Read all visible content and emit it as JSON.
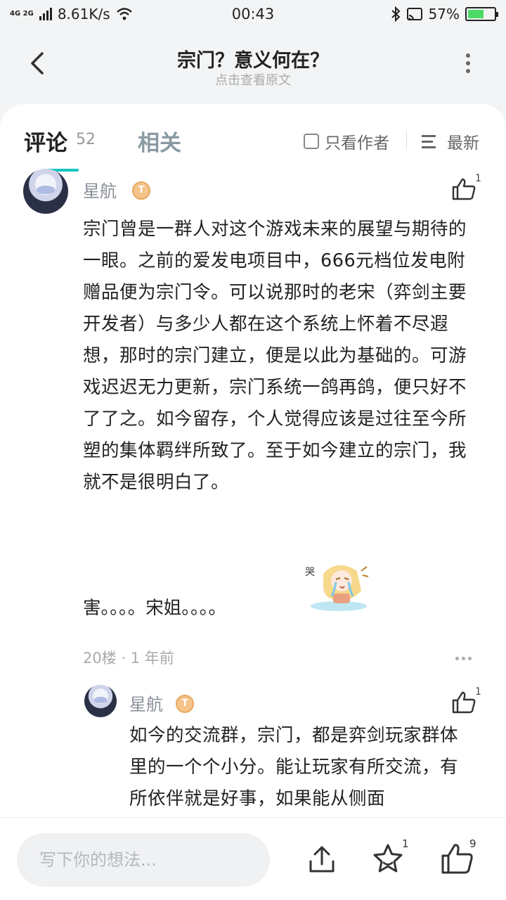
{
  "status_bar": {
    "network": "4G 2G",
    "speed": "8.61K/s",
    "time": "00:43",
    "battery": "57%"
  },
  "header": {
    "title": "宗门？意义何在？",
    "subtitle": "点击查看原文"
  },
  "tabs": {
    "comments_label": "评论",
    "comments_count": "52",
    "related_label": "相关",
    "only_author_label": "只看作者",
    "sort_label": "最新"
  },
  "comments": [
    {
      "author": "星航",
      "badge": "T",
      "likes": "1",
      "body": "宗门曾是一群人对这个游戏未来的展望与期待的一眼。之前的爱发电项目中，666元档位发电附赠品便为宗门令。可以说那时的老宋（弈剑主要开发者）与多少人都在这个系统上怀着不尽遐想，那时的宗门建立，便是以此为基础的。可游戏迟迟无力更新，宗门系统一鸽再鸽，便只好不了了之。如今留存，个人觉得应该是过往至今所塑的集体羁绊所致了。至于如今建立的宗门，我就不是很明白了。",
      "tail": "害。。。。宋姐。。。。",
      "meta": "20楼 · 1 年前"
    }
  ],
  "reply": {
    "author": "星航",
    "badge": "T",
    "likes": "1",
    "body": "如今的交流群，宗门，都是弈剑玩家群体里的一个个小分。能让玩家有所交流，有所依伴就是好事，如果能从侧面"
  },
  "bottom_bar": {
    "input_placeholder": "写下你的想法...",
    "favorite_count": "1",
    "like_count": "9"
  },
  "colors": {
    "accent": "#14c4c4",
    "page_bg": "#f2f4f5",
    "badge": "#f4c48a"
  },
  "icons": [
    "back-arrow-icon",
    "more-vertical-icon",
    "checkbox-icon",
    "sort-icon",
    "thumbs-up-icon",
    "share-icon",
    "star-icon",
    "more-horizontal-icon",
    "wifi-icon",
    "bluetooth-icon",
    "cast-icon",
    "battery-icon"
  ]
}
